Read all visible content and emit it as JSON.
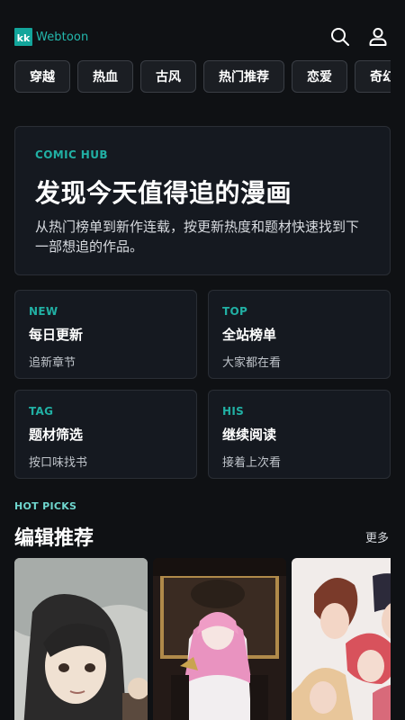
{
  "header": {
    "logo_mark": "kk",
    "logo_text": "Webtoon",
    "icons": [
      "search-icon",
      "user-icon"
    ]
  },
  "tags": [
    "穿越",
    "热血",
    "古风",
    "热门推荐",
    "恋爱",
    "奇幻"
  ],
  "hero": {
    "kicker": "COMIC HUB",
    "title": "发现今天值得追的漫画",
    "description": "从热门榜单到新作连载，按更新热度和题材快速找到下一部想追的作品。"
  },
  "quick_cards": [
    {
      "kicker": "NEW",
      "title": "每日更新",
      "subtitle": "追新章节"
    },
    {
      "kicker": "TOP",
      "title": "全站榜单",
      "subtitle": "大家都在看"
    },
    {
      "kicker": "TAG",
      "title": "题材筛选",
      "subtitle": "按口味找书"
    },
    {
      "kicker": "HIS",
      "title": "继续阅读",
      "subtitle": "接着上次看"
    }
  ],
  "section": {
    "kicker": "HOT PICKS",
    "title": "编辑推荐",
    "more": "更多"
  },
  "colors": {
    "background": "#0f1114",
    "accent": "#21b0a4",
    "card": "#151920",
    "border": "#2a2e35"
  }
}
